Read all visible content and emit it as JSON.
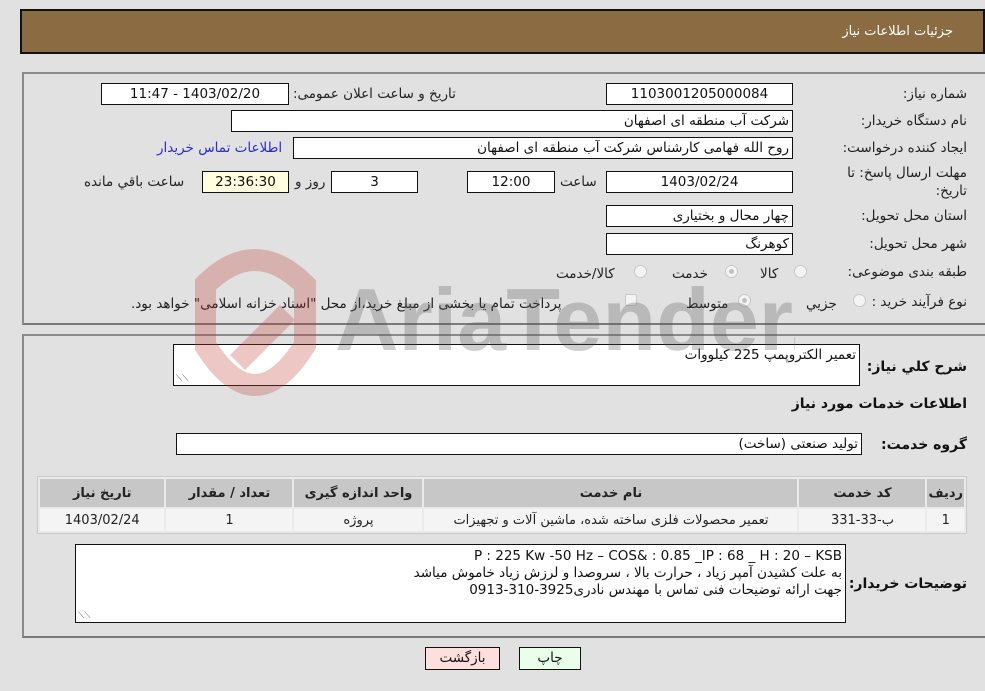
{
  "header": {
    "title": "جزئیات اطلاعات نیاز"
  },
  "details": {
    "need_number": {
      "label": "شماره نیاز:",
      "value": "1103001205000084"
    },
    "announce_datetime": {
      "label": "تاریخ و ساعت اعلان عمومی:",
      "value": "1403/02/20 - 11:47"
    },
    "buyer_org": {
      "label": "نام دستگاه خریدار:",
      "value": "شرکت آب منطقه ای اصفهان"
    },
    "requester": {
      "label": "ایجاد کننده درخواست:",
      "value": "روح الله فهامی کارشناس شرکت آب منطقه ای اصفهان"
    },
    "buyer_contact_link": "اطلاعات تماس خریدار",
    "deadline": {
      "label": "مهلت ارسال پاسخ: تا تاریخ:",
      "date": "1403/02/24",
      "time_label": "ساعت",
      "time": "12:00",
      "days": "3",
      "days_label": "روز و",
      "remaining": "23:36:30",
      "remaining_label": "ساعت باقي مانده"
    },
    "province": {
      "label": "استان محل تحویل:",
      "value": "چهار محال و بختیاری"
    },
    "city": {
      "label": "شهر محل تحویل:",
      "value": "کوهرنگ"
    },
    "category": {
      "label": "طبقه بندی موضوعی:",
      "options": [
        "کالا",
        "خدمت",
        "کالا/خدمت"
      ],
      "selected": "خدمت"
    },
    "purchase_process": {
      "label": "نوع فرآیند خرید :",
      "options": [
        "جزیي",
        "متوسط"
      ],
      "selected": "متوسط",
      "treasury_note": "پرداخت تمام یا بخشی از مبلغ خرید،از محل \"اسناد خزانه اسلامی\" خواهد بود."
    }
  },
  "summary": {
    "label": "شرح کلي نیاز:",
    "value": "تعمیر الکتروپمپ 225 کیلووات"
  },
  "services_section_title": "اطلاعات خدمات مورد نیاز",
  "service_group": {
    "label": "گروه خدمت:",
    "value": "تولید صنعتی (ساخت)"
  },
  "table": {
    "headers": [
      "ردیف",
      "کد خدمت",
      "نام خدمت",
      "واحد اندازه گیری",
      "تعداد / مقدار",
      "تاریخ نیاز"
    ],
    "rows": [
      [
        "1",
        "ب-33-331",
        "تعمیر محصولات فلزی ساخته شده، ماشین آلات و تجهیزات",
        "پروژه",
        "1",
        "1403/02/24"
      ]
    ]
  },
  "buyer_notes": {
    "label": "توضیحات خریدار:",
    "lines": [
      "P : 225 Kw -50 Hz – COS& : 0.85 _IP : 68 _ H : 20 – KSB",
      "به علت کشیدن آمپر زیاد ، حرارت بالا ، سروصدا و لرزش زیاد خاموش میاشد",
      "جهت ارائه توضیحات فنی تماس با مهندس نادری3925-310-0913"
    ]
  },
  "buttons": {
    "print": "چاپ",
    "back": "بازگشت"
  },
  "colors": {
    "header_bg": "#8b6c42",
    "print_bg": "#eaffea",
    "back_bg": "#ffdede",
    "link": "#2b2bcc"
  },
  "watermark": {
    "text": "AriaTender.neT"
  }
}
